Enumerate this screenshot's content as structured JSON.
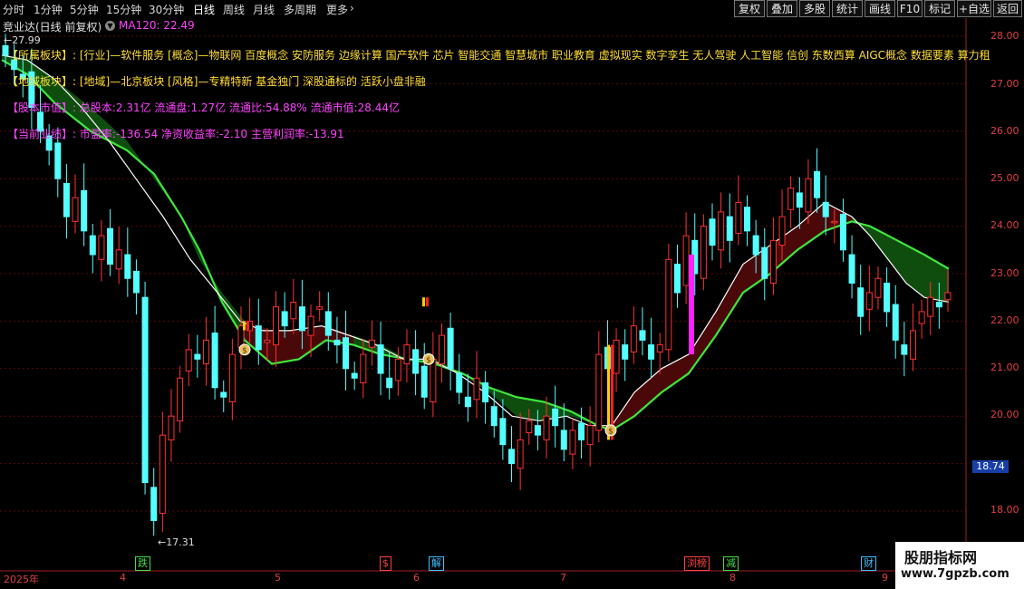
{
  "toolbar": {
    "periods": [
      "分时",
      "1分钟",
      "5分钟",
      "15分钟",
      "30分钟",
      "日线",
      "周线",
      "月线",
      "多周期",
      "更多"
    ],
    "active_period": "日线",
    "right_buttons": [
      "复权",
      "叠加",
      "多股",
      "统计",
      "画线",
      "F10",
      "标记",
      "+自选",
      "返回"
    ]
  },
  "title": {
    "stock_name": "竞业达(日线 前复权)",
    "ma_label": "MA120: 22.49"
  },
  "info": {
    "line1": "【所属板块】: [行业]—软件服务 [概念]—物联网 百度概念 安防服务 边缘计算 国产软件 芯片 智能交通 智慧城市 职业教育 虚拟现实 数字孪生 无人驾驶 人工智能 信创 东数西算 AIGC概念 数据要素 算力租",
    "line2": "【地域板块】: [地域]—北京板块 [风格]—专精特新 基金独门 深股通标的 活跃小盘非融",
    "line3": "【股本市值】: 总股本:2.31亿 流通盘:1.27亿 流通比:54.88% 流通市值:28.44亿",
    "line4": "【当前业绩】: 市盈率:-136.54 净资收益率:-2.10 主营利润率:-13.91"
  },
  "price_axis": {
    "labels": [
      "28.00",
      "27.00",
      "26.00",
      "25.00",
      "24.00",
      "23.00",
      "22.00",
      "21.00",
      "20.00",
      "18.00"
    ],
    "current_price": "18.74"
  },
  "high_low": {
    "high": "27.99",
    "low": "17.31"
  },
  "x_axis": {
    "labels": [
      "2025年",
      "4",
      "5",
      "6",
      "7",
      "8",
      "9"
    ]
  },
  "event_markers": [
    {
      "text": "跌",
      "color": "#44dd44"
    },
    {
      "text": "$",
      "color": "#ff4040"
    },
    {
      "text": "解",
      "color": "#40c0ff"
    },
    {
      "text": "浏榜",
      "color": "#ff4040"
    },
    {
      "text": "减",
      "color": "#44dd44"
    },
    {
      "text": "财",
      "color": "#40c0ff"
    }
  ],
  "watermark": {
    "title": "股朋指标网",
    "url": "www.7gpzb.com"
  },
  "colors": {
    "up": "#ff3030",
    "down": "#54ffff",
    "green_band": "#0f4d0f",
    "red_band": "#4a0808",
    "green_line": "#3de83d",
    "white_line": "#ffffff",
    "magenta": "#ff22ff"
  }
}
